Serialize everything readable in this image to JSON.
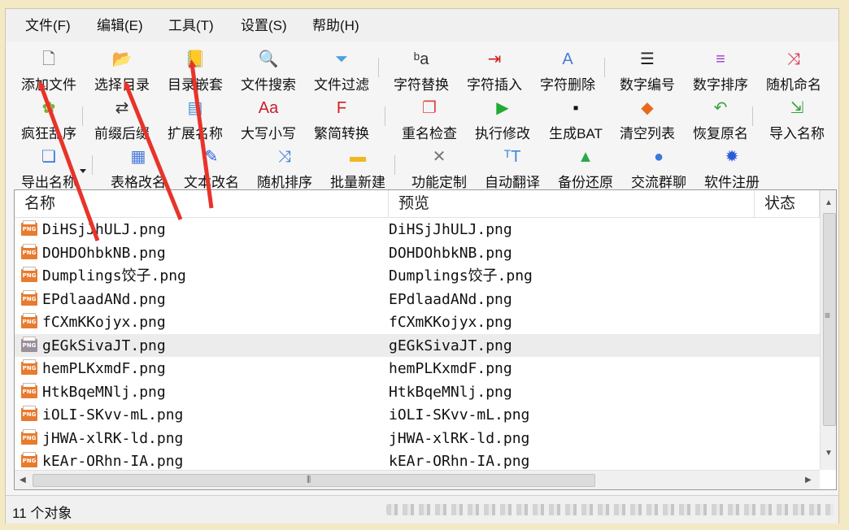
{
  "menu": [
    "文件(F)",
    "编辑(E)",
    "工具(T)",
    "设置(S)",
    "帮助(H)"
  ],
  "toolbar": {
    "row1": [
      {
        "label": "添加文件",
        "icon": "add-file-icon"
      },
      {
        "label": "选择目录",
        "icon": "folder-open-icon"
      },
      {
        "label": "目录嵌套",
        "icon": "nested-folder-icon"
      },
      {
        "label": "文件搜索",
        "icon": "magnifier-icon"
      },
      {
        "label": "文件过滤",
        "icon": "funnel-icon"
      },
      {
        "label": "字符替换",
        "icon": "replace-chars-icon"
      },
      {
        "label": "字符插入",
        "icon": "insert-chars-icon"
      },
      {
        "label": "字符删除",
        "icon": "delete-chars-icon"
      },
      {
        "label": "数字编号",
        "icon": "numbered-list-icon"
      },
      {
        "label": "数字排序",
        "icon": "sort-lines-icon"
      },
      {
        "label": "随机命名",
        "icon": "shuffle-icon"
      }
    ],
    "row2": [
      {
        "label": "疯狂乱序",
        "icon": "crazy-shuffle-icon"
      },
      {
        "label": "前缀后缀",
        "icon": "prefix-suffix-icon"
      },
      {
        "label": "扩展名称",
        "icon": "extension-icon"
      },
      {
        "label": "大写小写",
        "icon": "case-icon"
      },
      {
        "label": "繁简转换",
        "icon": "traditional-simplified-icon"
      },
      {
        "label": "重名检查",
        "icon": "duplicate-check-icon"
      },
      {
        "label": "执行修改",
        "icon": "play-icon"
      },
      {
        "label": "生成BAT",
        "icon": "terminal-icon"
      },
      {
        "label": "清空列表",
        "icon": "eraser-icon"
      },
      {
        "label": "恢复原名",
        "icon": "undo-icon"
      },
      {
        "label": "导入名称",
        "icon": "import-icon"
      }
    ],
    "row3": [
      {
        "label": "导出名称",
        "icon": "export-icon"
      },
      {
        "label": "表格改名",
        "icon": "table-icon"
      },
      {
        "label": "文本改名",
        "icon": "edit-text-icon"
      },
      {
        "label": "随机排序",
        "icon": "random-sort-icon"
      },
      {
        "label": "批量新建",
        "icon": "new-folder-icon"
      },
      {
        "label": "功能定制",
        "icon": "tools-icon"
      },
      {
        "label": "自动翻译",
        "icon": "translate-icon"
      },
      {
        "label": "备份还原",
        "icon": "drive-icon"
      },
      {
        "label": "交流群聊",
        "icon": "chat-icon"
      },
      {
        "label": "软件注册",
        "icon": "gear-icon"
      }
    ]
  },
  "list": {
    "headers": [
      "名称",
      "预览",
      "状态"
    ],
    "rows": [
      {
        "name": "DiHSjJhULJ.png",
        "preview": "DiHSjJhULJ.png"
      },
      {
        "name": "DOHDOhbkNB.png",
        "preview": "DOHDOhbkNB.png"
      },
      {
        "name": "Dumplings饺子.png",
        "preview": "Dumplings饺子.png"
      },
      {
        "name": "EPdlaadANd.png",
        "preview": "EPdlaadANd.png"
      },
      {
        "name": "fCXmKKojyx.png",
        "preview": "fCXmKKojyx.png"
      },
      {
        "name": "gEGkSivaJT.png",
        "preview": "gEGkSivaJT.png",
        "highlighted": true
      },
      {
        "name": "hemPLKxmdF.png",
        "preview": "hemPLKxmdF.png"
      },
      {
        "name": "HtkBqeMNlj.png",
        "preview": "HtkBqeMNlj.png"
      },
      {
        "name": "iOLI-SKvv-mL.png",
        "preview": "iOLI-SKvv-mL.png"
      },
      {
        "name": "jHWA-xlRK-ld.png",
        "preview": "jHWA-xlRK-ld.png"
      },
      {
        "name": "kEAr-ORhn-IA.png",
        "preview": "kEAr-ORhn-IA.png"
      }
    ]
  },
  "status": {
    "count_text": "11 个对象"
  },
  "colors": {
    "annotation_arrow": "#e8332a",
    "png_icon": "#e77b2f"
  }
}
